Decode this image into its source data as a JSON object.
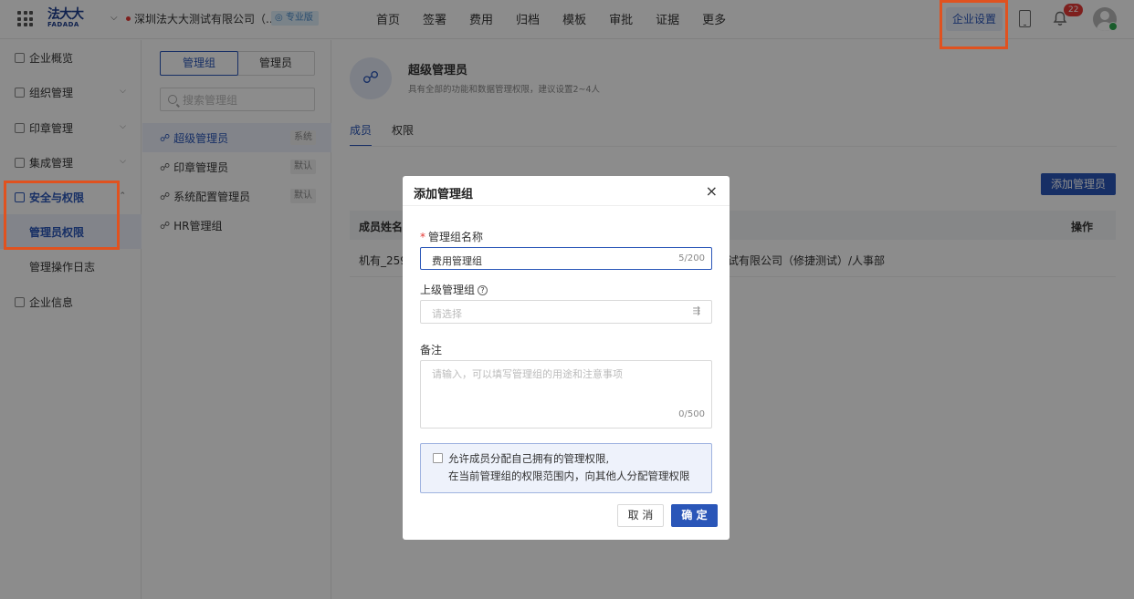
{
  "header": {
    "logo_cn": "法大大",
    "logo_en": "FADADA",
    "company_name": "深圳法大大测试有限公司（...",
    "edition_badge": "◎ 专业版",
    "nav": [
      "首页",
      "签署",
      "费用",
      "归档",
      "模板",
      "审批",
      "证据",
      "更多"
    ],
    "settings_label": "企业设置",
    "notif_count": "22"
  },
  "sidebar": {
    "items": [
      {
        "label": "企业概览"
      },
      {
        "label": "组织管理"
      },
      {
        "label": "印章管理"
      },
      {
        "label": "集成管理"
      },
      {
        "label": "安全与权限"
      },
      {
        "label": "管理员权限"
      },
      {
        "label": "管理操作日志"
      },
      {
        "label": "企业信息"
      }
    ]
  },
  "groups_panel": {
    "seg_group": "管理组",
    "seg_admin": "管理员",
    "search_placeholder": "搜索管理组",
    "groups": [
      {
        "label": "超级管理员",
        "tag": "系统"
      },
      {
        "label": "印章管理员",
        "tag": "默认"
      },
      {
        "label": "系统配置管理员",
        "tag": "默认"
      },
      {
        "label": "HR管理组",
        "tag": ""
      }
    ]
  },
  "main": {
    "title": "超级管理员",
    "desc": "具有全部的功能和数据管理权限，建议设置2~4人",
    "tab_members": "成员",
    "tab_perms": "权限",
    "add_admin": "添加管理员",
    "th_name": "成员姓名",
    "th_op": "操作",
    "row_name": "机有_259",
    "row_dept": "试有限公司（修捷测试）/人事部"
  },
  "modal": {
    "title": "添加管理组",
    "close": "×",
    "name_label": "管理组名称",
    "name_value": "费用管理组",
    "name_count": "5/200",
    "parent_label": "上级管理组",
    "parent_placeholder": "请选择",
    "note_label": "备注",
    "note_placeholder": "请输入，可以填写管理组的用途和注意事项",
    "note_count": "0/500",
    "checkbox_line1": "允许成员分配自己拥有的管理权限,",
    "checkbox_line2": "在当前管理组的权限范围内，向其他人分配管理权限",
    "cancel": "取 消",
    "ok": "确 定"
  },
  "colors": {
    "brand": "#2a56b8",
    "highlight": "#e0521f"
  }
}
